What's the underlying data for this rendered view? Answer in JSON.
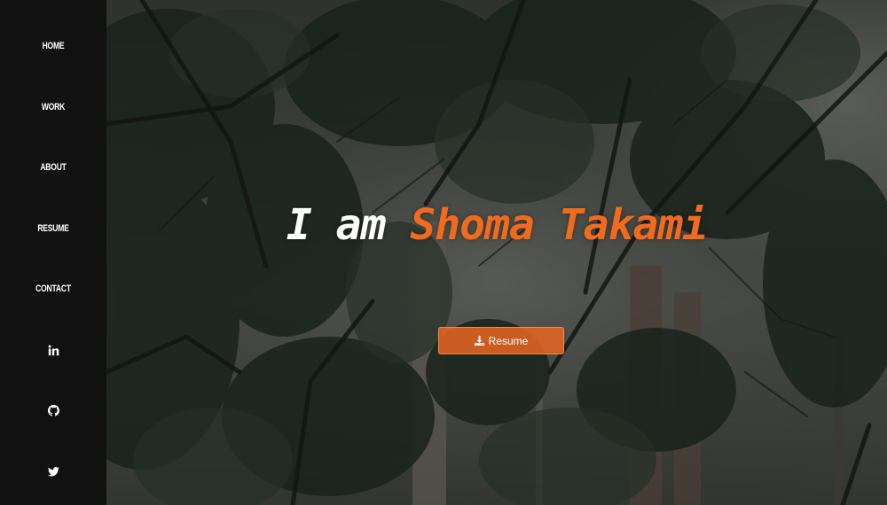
{
  "sidebar": {
    "nav": [
      {
        "label": "HOME"
      },
      {
        "label": "WORK"
      },
      {
        "label": "ABOUT"
      },
      {
        "label": "RESUME"
      },
      {
        "label": "CONTACT"
      }
    ],
    "social": [
      {
        "icon": "linkedin-icon"
      },
      {
        "icon": "github-icon"
      },
      {
        "icon": "twitter-icon"
      }
    ]
  },
  "hero": {
    "headline_lead": "I am",
    "headline_name": "Shoma Takami",
    "resume_button_label": "Resume",
    "resume_button_icon": "download-icon",
    "accent_color": "#f26b1d"
  }
}
